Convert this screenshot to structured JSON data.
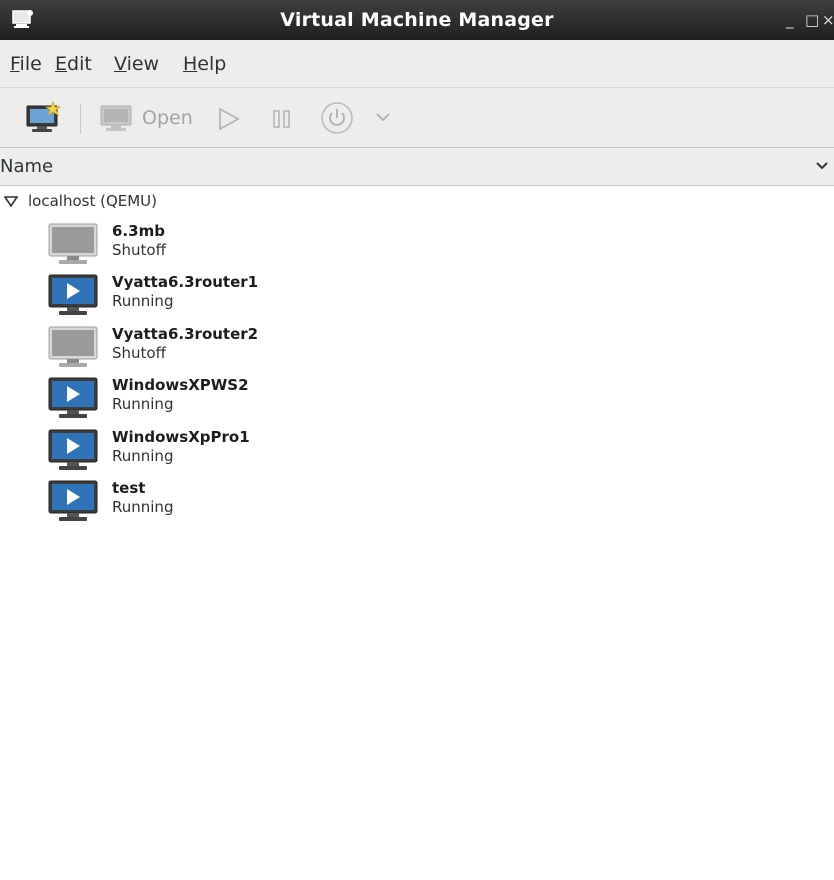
{
  "window": {
    "title": "Virtual Machine Manager",
    "app_icon": "monitor-icon",
    "controls": {
      "minimize": "_",
      "maximize": "□",
      "close": "×"
    }
  },
  "menubar": {
    "items": [
      {
        "label_underlined": "F",
        "label_rest": "ile"
      },
      {
        "label_underlined": "E",
        "label_rest": "dit"
      },
      {
        "label_underlined": "V",
        "label_rest": "iew"
      },
      {
        "label_underlined": "H",
        "label_rest": "elp"
      }
    ]
  },
  "toolbar": {
    "new_vm_icon": "new-vm-icon",
    "open_label": "Open",
    "run_icon": "play-icon",
    "pause_icon": "pause-icon",
    "shutdown_icon": "power-icon",
    "shutdown_menu_icon": "chevron-down-icon"
  },
  "list_header": {
    "column_name": "Name"
  },
  "connection": {
    "label": "localhost (QEMU)",
    "vms": [
      {
        "name": "6.3mb",
        "status": "Shutoff"
      },
      {
        "name": "Vyatta6.3router1",
        "status": "Running"
      },
      {
        "name": "Vyatta6.3router2",
        "status": "Shutoff"
      },
      {
        "name": "WindowsXPWS2",
        "status": "Running"
      },
      {
        "name": "WindowsXpPro1",
        "status": "Running"
      },
      {
        "name": "test",
        "status": "Running"
      }
    ]
  },
  "colors": {
    "running_screen": "#2f73b9",
    "shutoff_screen": "#9a9a9a",
    "titlebar": "#2a2a2a"
  }
}
